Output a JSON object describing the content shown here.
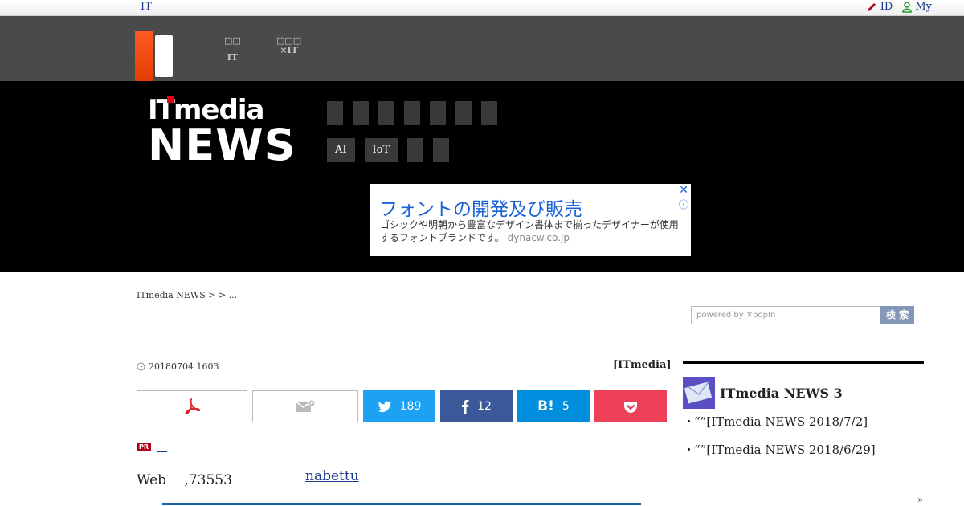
{
  "topbar": {
    "it_link": "IT",
    "id_label": "ID",
    "my_label": "My"
  },
  "global_nav": [
    {
      "line1": "□□",
      "line2": "IT"
    },
    {
      "line1": "□□□",
      "line2": "×IT"
    }
  ],
  "brand": {
    "line1_it": "IT",
    "line1_media": "media",
    "line2": "NEWS"
  },
  "categories": {
    "row1_count": 7,
    "row2": [
      "AI",
      "IoT",
      "",
      ""
    ]
  },
  "ad": {
    "title": "フォントの開発及び販売",
    "body": "ゴシックや明朝から豊富なデザイン書体まで揃ったデザイナーが使用するフォントブランドです。",
    "url": "dynacw.co.jp",
    "close": "✕",
    "info": "ⓘ"
  },
  "breadcrumb": "ITmedia NEWS >  > ...",
  "search": {
    "placeholder": "powered by ✕popIn",
    "button": "検 索"
  },
  "article": {
    "date": "20180704 1603",
    "source": "[ITmedia]",
    "share": {
      "twitter_count": "189",
      "facebook_count": "12",
      "hatena_count": "5"
    },
    "pr_badge": "PR",
    "pr_link": "＿",
    "author_text": "Web 　,73553",
    "author_link": "nabettu"
  },
  "sidebar": {
    "title": "ITmedia NEWS 3",
    "items": [
      {
        "text": "“”[ITmedia NEWS 2018/7/2]"
      },
      {
        "text": "“”[ITmedia NEWS 2018/6/29]"
      }
    ],
    "more": "»"
  },
  "colors": {
    "twitter": "#1da1f2",
    "facebook": "#3b5998",
    "hatena": "#008fde",
    "pocket": "#ee4056",
    "accent_red": "#e03c00"
  }
}
